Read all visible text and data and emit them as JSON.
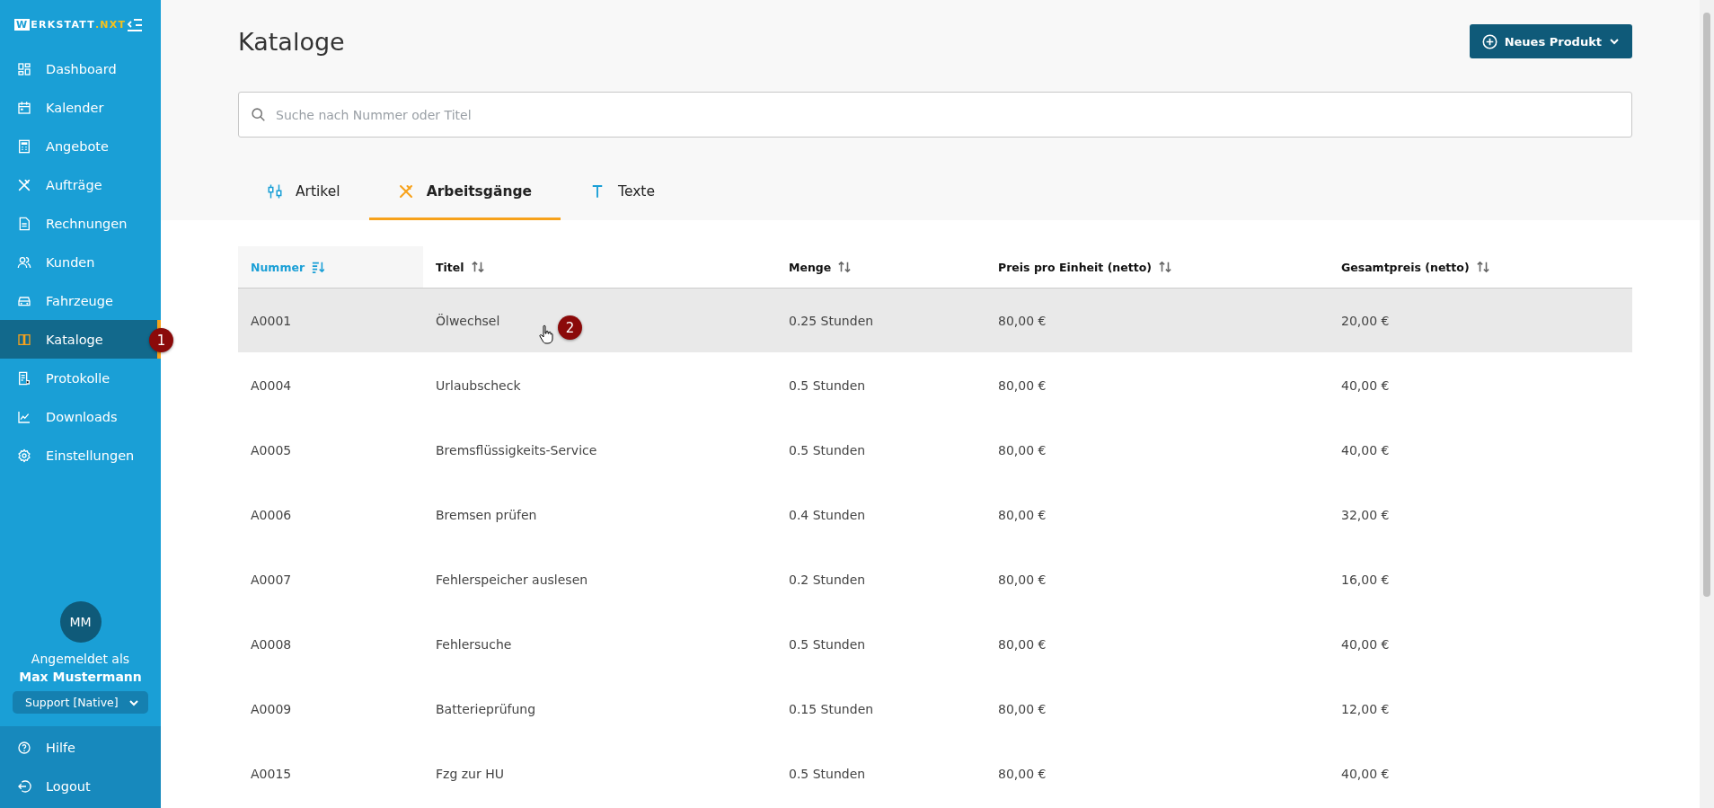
{
  "sidebar": {
    "logo_letter": "W",
    "logo_text": "ERKSTATT",
    "logo_accent": ".NXT",
    "items": [
      {
        "label": "Dashboard",
        "selected": false
      },
      {
        "label": "Kalender",
        "selected": false
      },
      {
        "label": "Angebote",
        "selected": false
      },
      {
        "label": "Aufträge",
        "selected": false
      },
      {
        "label": "Rechnungen",
        "selected": false
      },
      {
        "label": "Kunden",
        "selected": false
      },
      {
        "label": "Fahrzeuge",
        "selected": false
      },
      {
        "label": "Kataloge",
        "selected": true
      },
      {
        "label": "Protokolle",
        "selected": false
      },
      {
        "label": "Downloads",
        "selected": false
      },
      {
        "label": "Einstellungen",
        "selected": false
      }
    ],
    "user": {
      "initials": "MM",
      "caption": "Angemeldet als",
      "name": "Max Mustermann",
      "role": "Support [Native]"
    },
    "footer_items": [
      {
        "label": "Hilfe"
      },
      {
        "label": "Logout"
      }
    ]
  },
  "page": {
    "title": "Kataloge",
    "new_button": "Neues Produkt",
    "search": {
      "placeholder": "Suche nach Nummer oder Titel"
    }
  },
  "tabs": [
    {
      "label": "Artikel",
      "selected": false
    },
    {
      "label": "Arbeitsgänge",
      "selected": true
    },
    {
      "label": "Texte",
      "selected": false
    }
  ],
  "table": {
    "columns": [
      {
        "label": "Nummer",
        "sorted": true
      },
      {
        "label": "Titel",
        "sorted": false
      },
      {
        "label": "Menge",
        "sorted": false
      },
      {
        "label": "Preis pro Einheit (netto)",
        "sorted": false
      },
      {
        "label": "Gesamtpreis (netto)",
        "sorted": false
      }
    ],
    "rows": [
      {
        "highlighted": true,
        "cells": [
          "A0001",
          "Ölwechsel",
          "0.25 Stunden",
          "80,00 €",
          "20,00 €"
        ]
      },
      {
        "highlighted": false,
        "cells": [
          "A0004",
          "Urlaubscheck",
          "0.5 Stunden",
          "80,00 €",
          "40,00 €"
        ]
      },
      {
        "highlighted": false,
        "cells": [
          "A0005",
          "Bremsflüssigkeits-Service",
          "0.5 Stunden",
          "80,00 €",
          "40,00 €"
        ]
      },
      {
        "highlighted": false,
        "cells": [
          "A0006",
          "Bremsen prüfen",
          "0.4 Stunden",
          "80,00 €",
          "32,00 €"
        ]
      },
      {
        "highlighted": false,
        "cells": [
          "A0007",
          "Fehlerspeicher auslesen",
          "0.2 Stunden",
          "80,00 €",
          "16,00 €"
        ]
      },
      {
        "highlighted": false,
        "cells": [
          "A0008",
          "Fehlersuche",
          "0.5 Stunden",
          "80,00 €",
          "40,00 €"
        ]
      },
      {
        "highlighted": false,
        "cells": [
          "A0009",
          "Batterieprüfung",
          "0.15 Stunden",
          "80,00 €",
          "12,00 €"
        ]
      },
      {
        "highlighted": false,
        "cells": [
          "A0015",
          "Fzg zur HU",
          "0.5 Stunden",
          "80,00 €",
          "40,00 €"
        ]
      }
    ]
  },
  "markers": [
    {
      "label": "1"
    },
    {
      "label": "2"
    }
  ]
}
